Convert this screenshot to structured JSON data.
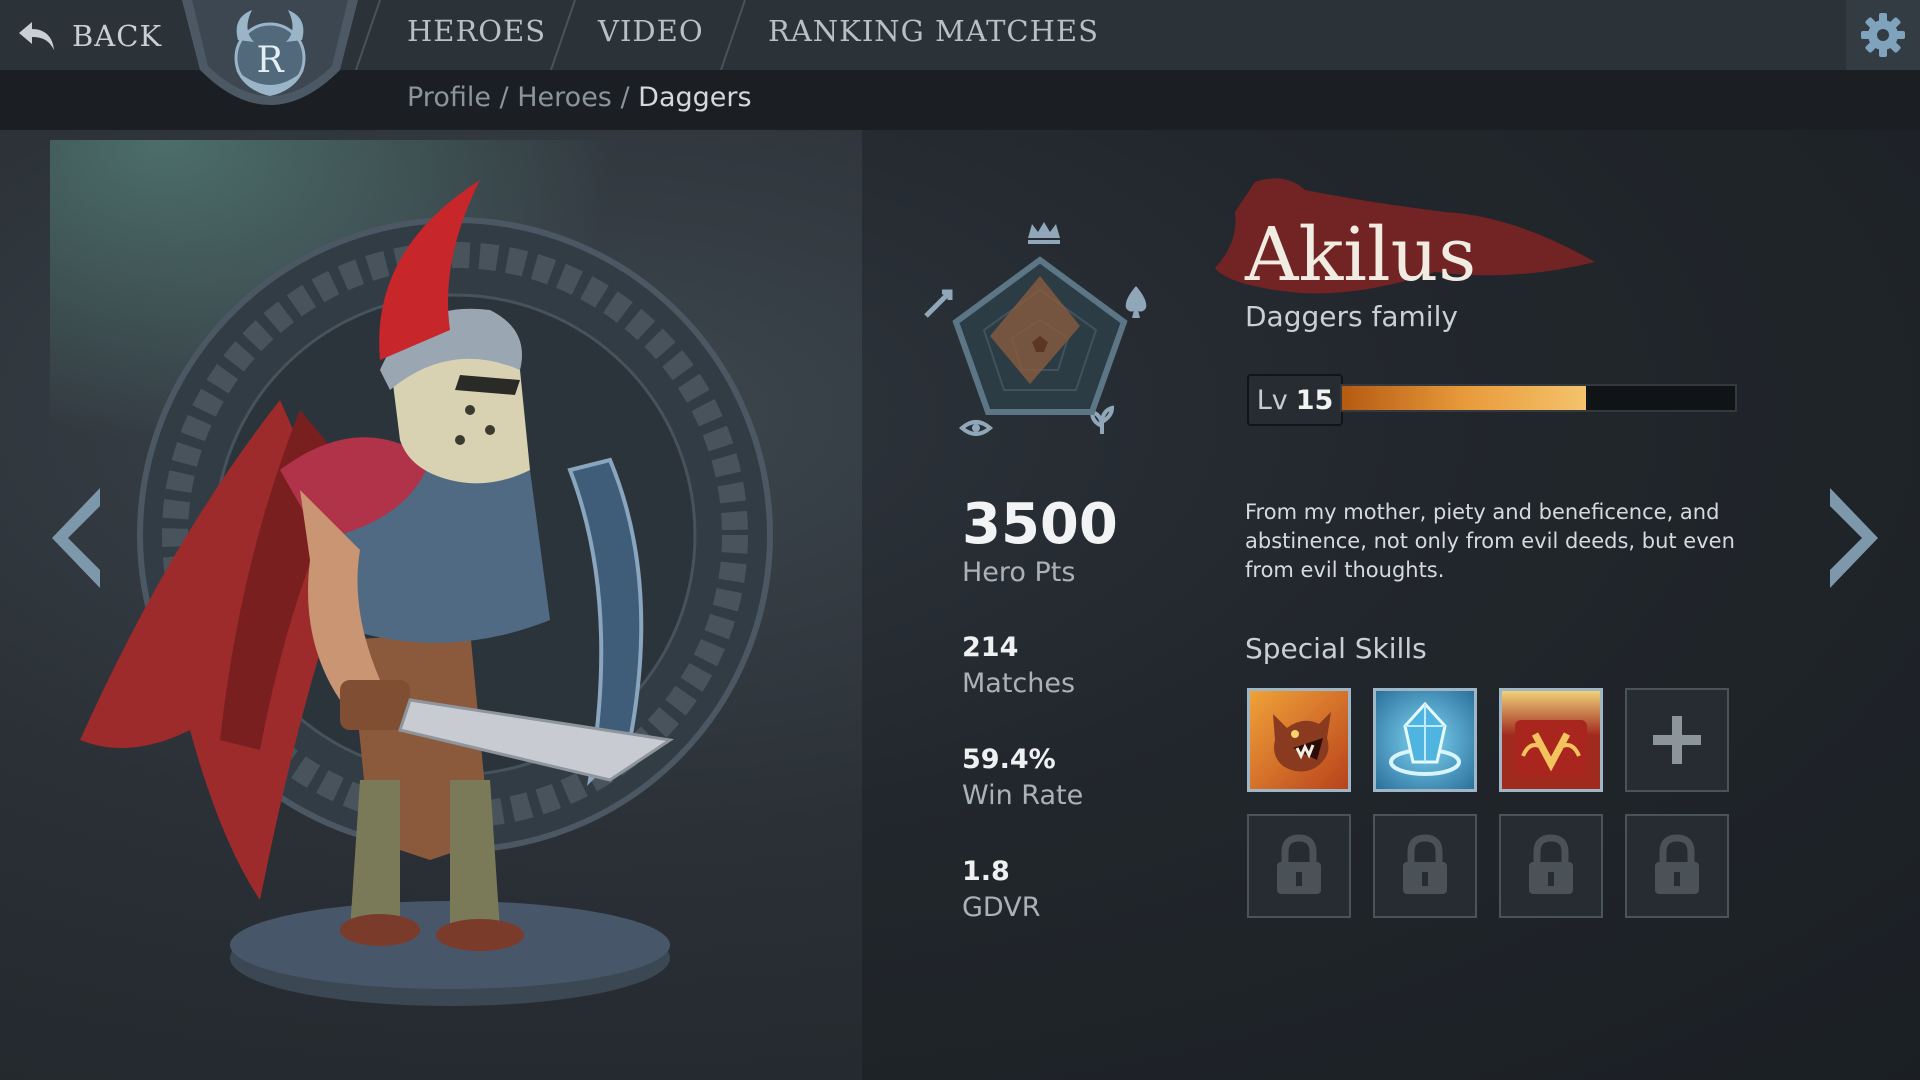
{
  "nav": {
    "back_label": "BACK",
    "items": [
      {
        "label": "HEROES"
      },
      {
        "label": "VIDEO"
      },
      {
        "label": "RANKING MATCHES"
      }
    ],
    "logo_icon": "crest-logo-icon",
    "settings_icon": "gear-icon"
  },
  "breadcrumb": {
    "items": [
      "Profile",
      "Heroes",
      "Daggers"
    ],
    "separator": "/"
  },
  "hero": {
    "name": "Akilus",
    "family": "Daggers family",
    "level_prefix": "Lv",
    "level": "15",
    "xp_fraction": 0.62,
    "bio": "From my mother, piety and beneficence, and abstinence, not only from evil deeds, but even from evil thoughts."
  },
  "stats": {
    "hero_pts_value": "3500",
    "hero_pts_label": "Hero Pts",
    "matches_value": "214",
    "matches_label": "Matches",
    "winrate_value": "59.4%",
    "winrate_label": "Win Rate",
    "gdvr_value": "1.8",
    "gdvr_label": "GDVR"
  },
  "skills": {
    "title": "Special Skills",
    "slots": [
      {
        "icon": "wolf-roar-icon",
        "state": "unlocked"
      },
      {
        "icon": "crystal-shield-icon",
        "state": "unlocked"
      },
      {
        "icon": "laurel-v-icon",
        "state": "unlocked"
      },
      {
        "icon": "plus-icon",
        "state": "add"
      },
      {
        "icon": "lock-icon",
        "state": "locked"
      },
      {
        "icon": "lock-icon",
        "state": "locked"
      },
      {
        "icon": "lock-icon",
        "state": "locked"
      },
      {
        "icon": "lock-icon",
        "state": "locked"
      }
    ]
  },
  "colors": {
    "accent_xp": "#e89a3a",
    "name_banner": "#7a2323",
    "topbar": "#2b3238"
  }
}
